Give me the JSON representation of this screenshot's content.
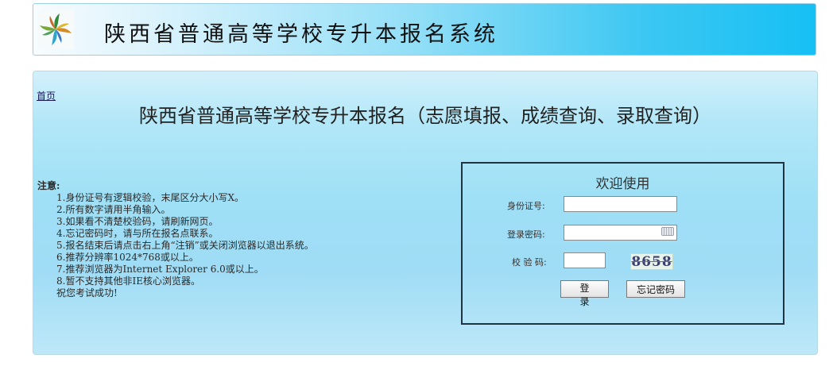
{
  "header": {
    "title": "陕西省普通高等学校专升本报名系统"
  },
  "nav": {
    "home_link": "首页"
  },
  "main": {
    "title": "陕西省普通高等学校专升本报名（志愿填报、成绩查询、录取查询）"
  },
  "notes": {
    "title": "注意:",
    "items": [
      "1.身份证号有逻辑校验，末尾区分大小写X。",
      "2.所有数字请用半角输入。",
      "3.如果看不清楚校验码，请刷新网页。",
      "4.忘记密码时，请与所在报名点联系。",
      "5.报名结束后请点击右上角“注销”或关闭浏览器以退出系统。",
      "6.推荐分辨率1024*768或以上。",
      "7.推荐浏览器为Internet Explorer 6.0或以上。",
      "8.暂不支持其他非IE核心浏览器。",
      "祝您考试成功!"
    ]
  },
  "login": {
    "welcome": "欢迎使用",
    "id_label": "身份证号:",
    "id_value": "",
    "password_label": "登录密码:",
    "password_value": "",
    "captcha_label": "校 验 码:",
    "captcha_value": "",
    "captcha_text": "8658",
    "login_button": "登 录",
    "forgot_button": "忘记密码"
  },
  "icons": {
    "logo": "pinwheel-logo-icon",
    "keyboard": "keyboard-icon"
  }
}
